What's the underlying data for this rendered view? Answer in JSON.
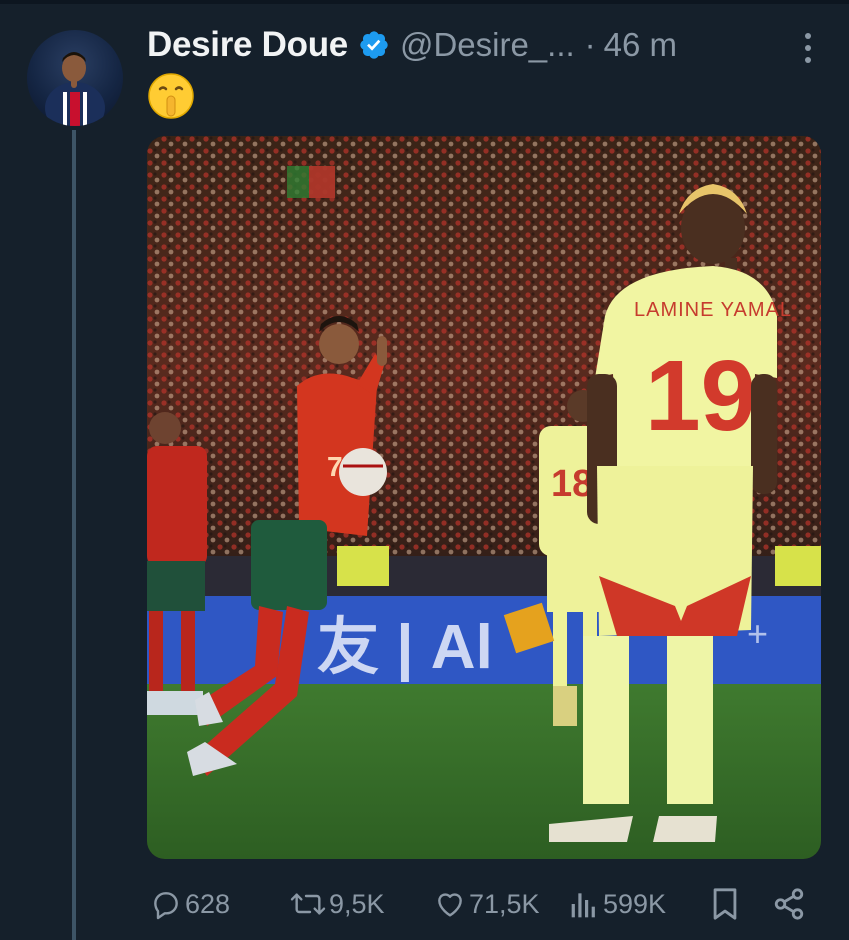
{
  "tweet": {
    "display_name": "Desire Doue",
    "handle": "@Desire_...",
    "separator": "·",
    "time": "46 m",
    "emoji": "🤫",
    "verified": true
  },
  "photo": {
    "jersey_name_text": "LAMINE YAMAL",
    "jersey_number_main": "19",
    "jersey_number_bg": "18",
    "jersey_number_portugal": "7"
  },
  "actions": {
    "replies": "628",
    "reposts": "9,5K",
    "likes": "71,5K",
    "views": "599K"
  },
  "icons": [
    "verified-badge-icon",
    "more-options-icon",
    "reply-icon",
    "repost-icon",
    "like-icon",
    "views-icon",
    "bookmark-icon",
    "share-icon"
  ],
  "colors": {
    "background": "#15202b",
    "text_primary": "#e7e9ea",
    "text_secondary": "#8b98a5",
    "verified": "#1d9bf0",
    "thread_line": "#3d5466"
  }
}
